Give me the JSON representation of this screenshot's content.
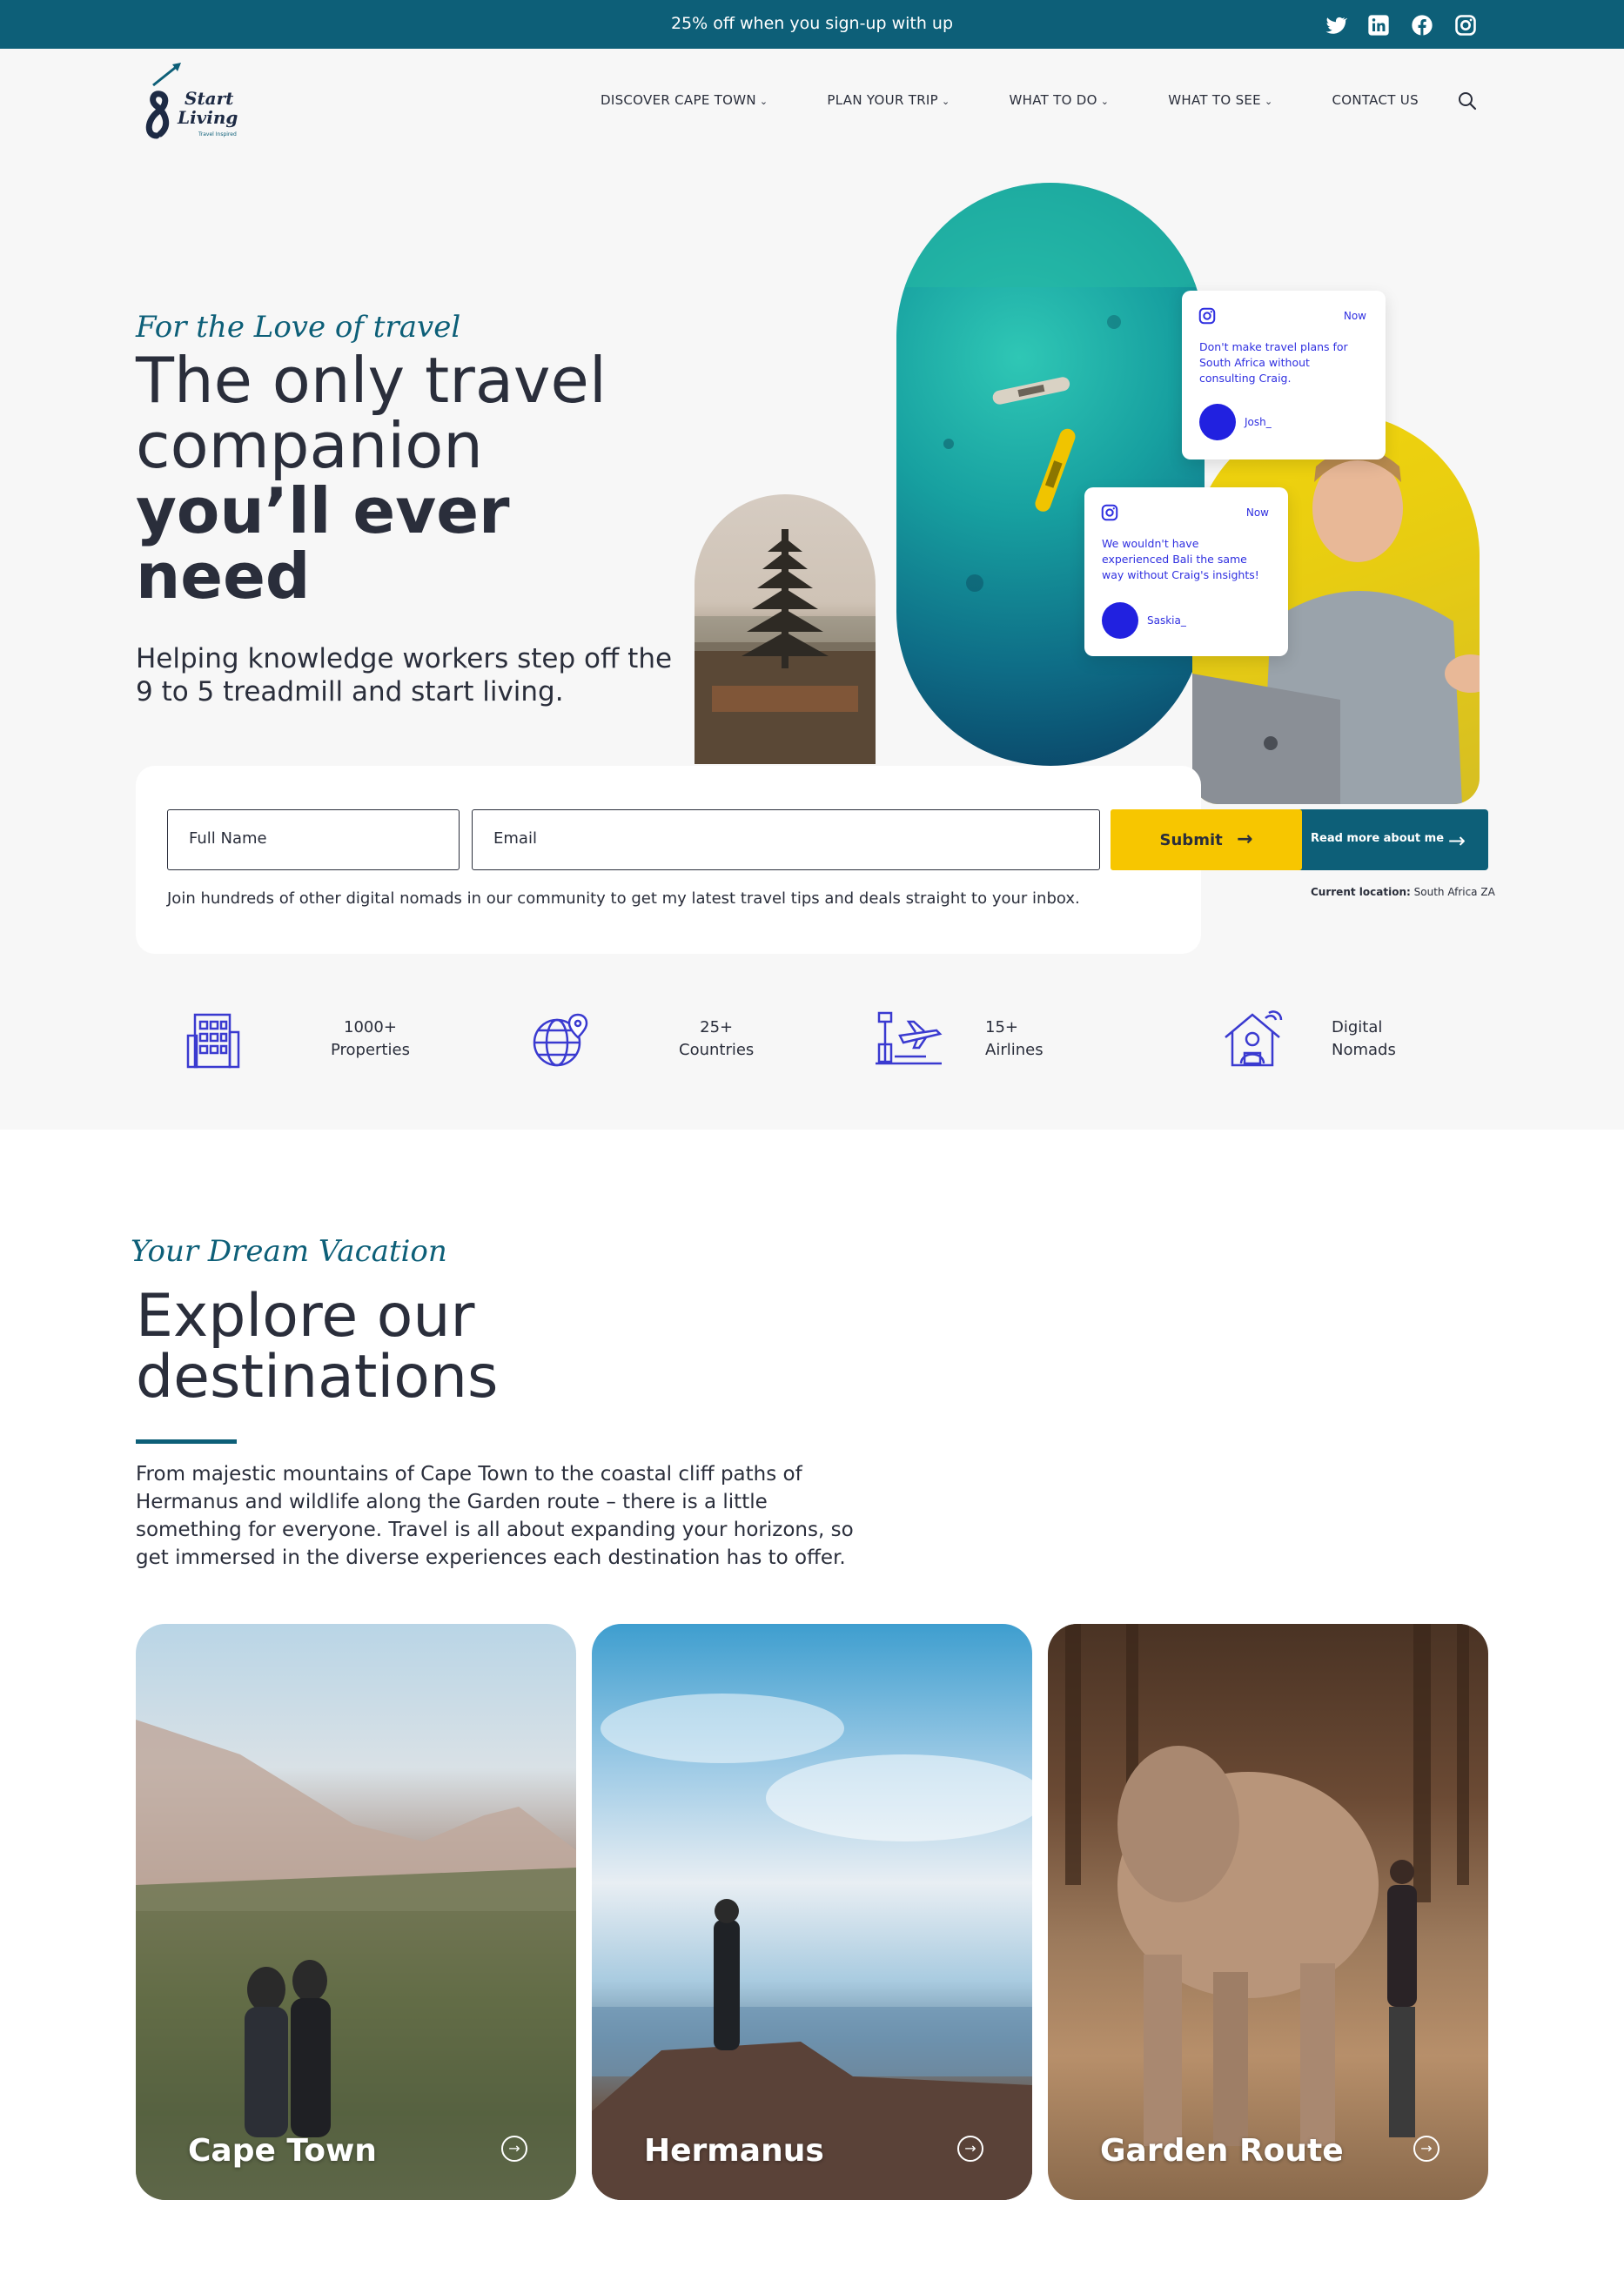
{
  "topbar": {
    "promo": "25% off when you sign-up with up",
    "socials": [
      "twitter-icon",
      "linkedin-icon",
      "facebook-icon",
      "instagram-icon"
    ]
  },
  "header": {
    "logo_text": "Start Living",
    "logo_tagline": "Travel Inspired",
    "nav": [
      {
        "label": "DISCOVER CAPE TOWN",
        "dropdown": true
      },
      {
        "label": "PLAN YOUR TRIP",
        "dropdown": true
      },
      {
        "label": "WHAT TO DO",
        "dropdown": true
      },
      {
        "label": "WHAT TO SEE",
        "dropdown": true
      },
      {
        "label": "CONTACT US",
        "dropdown": false
      }
    ]
  },
  "hero": {
    "eyebrow": "For the Love of travel",
    "title_line1": "The only travel",
    "title_line2": "companion",
    "title_bold1": "you’ll ever",
    "title_bold2": "need",
    "subtitle": "Helping knowledge workers step off the 9 to 5 treadmill and start living.",
    "cards": [
      {
        "time": "Now",
        "message": "Don't make travel plans for South Africa without consulting Craig.",
        "handle": "Josh_"
      },
      {
        "time": "Now",
        "message": "We wouldn't have experienced Bali the same way without Craig's insights!",
        "handle": "Saskia_"
      }
    ],
    "read_more": "Read more about me",
    "location_label": "Current location:",
    "location_value": "South Africa ZA"
  },
  "signup": {
    "name_placeholder": "Full Name",
    "email_placeholder": "Email",
    "submit_label": "Submit",
    "note": "Join hundreds of other digital nomads in our community to get my latest travel tips and deals straight to your inbox."
  },
  "stats": [
    {
      "icon": "building-icon",
      "line1": "1000+",
      "line2": "Properties"
    },
    {
      "icon": "globe-pin-icon",
      "line1": "25+",
      "line2": "Countries"
    },
    {
      "icon": "airport-icon",
      "line1": "15+",
      "line2": "Airlines"
    },
    {
      "icon": "nomad-house-icon",
      "line1": "Digital",
      "line2": "Nomads"
    }
  ],
  "destinations": {
    "eyebrow": "Your Dream Vacation",
    "title_line1": "Explore our",
    "title_line2": "destinations",
    "description": "From majestic mountains of Cape Town to the coastal cliff paths of Hermanus and wildlife along the Garden route – there is a little something for everyone. Travel is all about expanding your horizons, so get immersed in the diverse experiences each destination has to offer.",
    "cards": [
      {
        "name": "Cape Town"
      },
      {
        "name": "Hermanus"
      },
      {
        "name": "Garden Route"
      }
    ]
  },
  "colors": {
    "brand": "#0d5f78",
    "accent": "#f7c600",
    "instagram_blue": "#2f2fe0"
  }
}
